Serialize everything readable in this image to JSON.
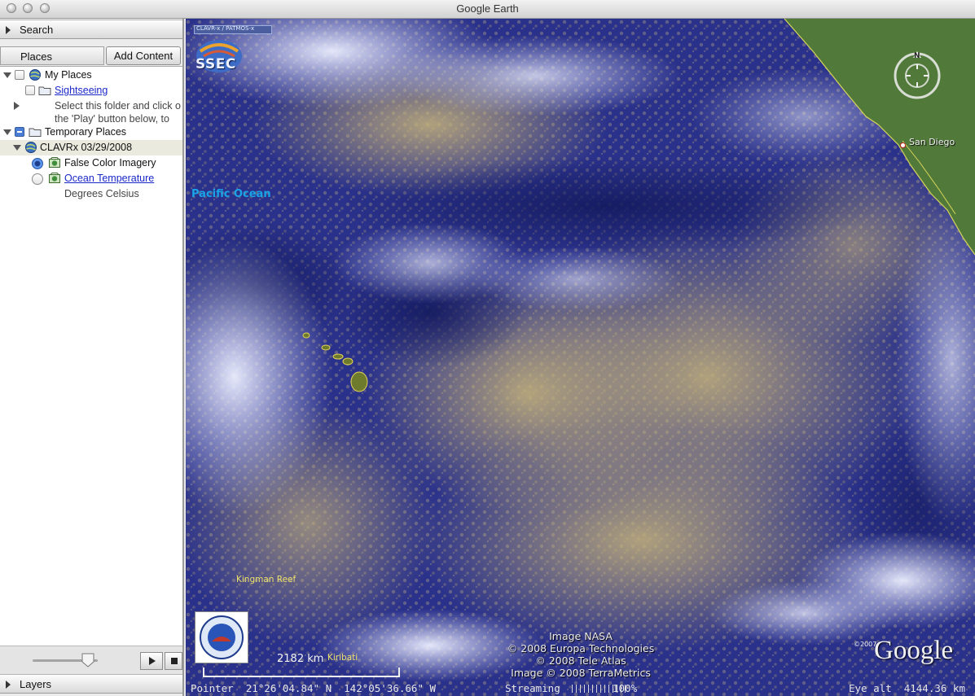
{
  "window": {
    "title": "Google Earth"
  },
  "sidebar": {
    "search_label": "Search",
    "places_label": "Places",
    "add_content_label": "Add Content",
    "layers_label": "Layers",
    "tree": {
      "my_places": "My Places",
      "sightseeing": "Sightseeing",
      "tour_hint_1": "Select this folder and click o",
      "tour_hint_2": "the 'Play' button below, to",
      "temporary_places": "Temporary Places",
      "clavrx": "CLAVRx 03/29/2008",
      "false_color": "False Color Imagery",
      "ocean_temp": "Ocean Temperature",
      "degrees": "Degrees Celsius"
    }
  },
  "map": {
    "logo_banner": "CLAVR-x / PATMOS-x",
    "logo_text": "SSEC",
    "pacific": "Pacific Ocean",
    "san_diego": "San Diego",
    "kingman": "Kingman Reef",
    "kiribati": "Kiribati",
    "scale": "2182 km",
    "credits": [
      "Image NASA",
      "© 2008 Europa Technologies",
      "© 2008 Tele Atlas",
      "Image © 2008 TerraMetrics"
    ],
    "google_year": "©2007",
    "google": "Google",
    "compass_n": "N"
  },
  "status": {
    "pointer": "Pointer  21°26'04.84\" N  142°05'36.66\" W",
    "streaming": "Streaming",
    "stream_pct": "100%",
    "eye_alt": "Eye alt  4144.36 km"
  },
  "colors": {
    "ocean": "#1c2470",
    "cloud_yellow": "#b8a86a",
    "cloud_white": "#e4e6f8",
    "link": "#1b28c9"
  }
}
